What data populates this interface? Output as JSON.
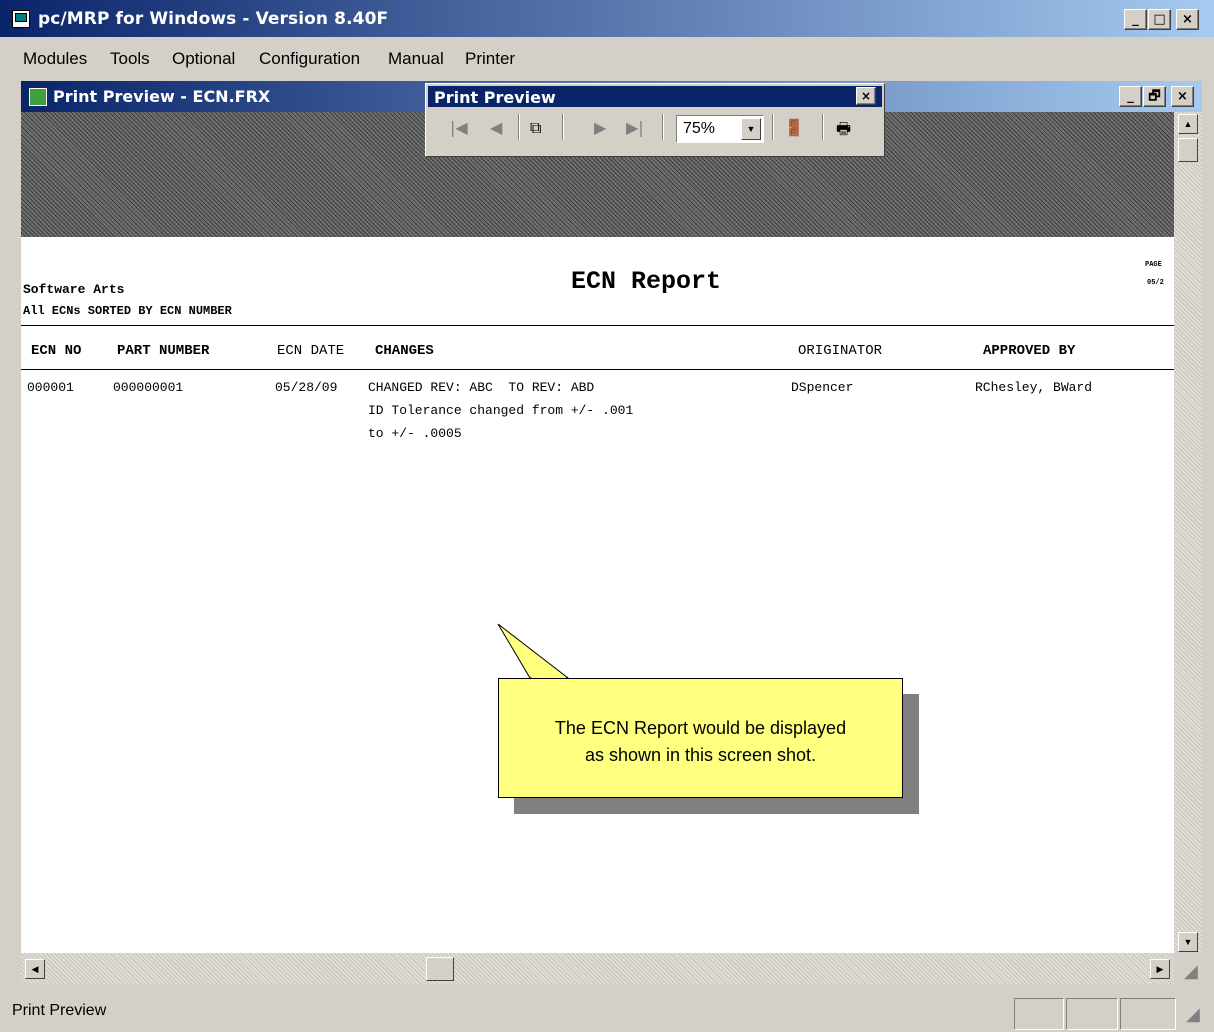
{
  "app": {
    "title": "pc/MRP for Windows - Version 8.40F",
    "min": "_",
    "max": "□",
    "close": "×"
  },
  "menu": [
    "Modules",
    "Tools",
    "Optional",
    "Configuration",
    "Manual",
    "Printer"
  ],
  "window": {
    "title": "Print Preview - ECN.FRX",
    "min": "_",
    "restore": "🗗",
    "close": "×"
  },
  "toolbar": {
    "title": "Print Preview",
    "close": "×",
    "zoom": "75%",
    "icons": {
      "first": "first-page-icon",
      "prev": "previous-page-icon",
      "goto": "go-to-page-icon",
      "next": "next-page-icon",
      "last": "last-page-icon",
      "exit": "exit-door-icon",
      "print": "printer-icon"
    }
  },
  "report": {
    "company": "Software Arts",
    "subtitle": "All ECNs SORTED BY ECN NUMBER",
    "title": "ECN Report",
    "page_label": "PAGE",
    "date_label": "05/2",
    "columns": [
      "ECN NO",
      "PART NUMBER",
      "ECN DATE",
      "CHANGES",
      "ORIGINATOR",
      "APPROVED BY"
    ],
    "rows": [
      {
        "ecn_no": "000001",
        "part_number": "000000001",
        "ecn_date": "05/28/09",
        "changes": [
          "CHANGED REV: ABC  TO REV: ABD",
          "ID Tolerance changed from +/- .001",
          "to +/- .0005"
        ],
        "originator": "DSpencer",
        "approved_by": "RChesley, BWard"
      }
    ]
  },
  "callout": {
    "line1": "The ECN Report would be displayed",
    "line2": "as shown in this screen shot."
  },
  "status": {
    "text": "Print Preview"
  }
}
